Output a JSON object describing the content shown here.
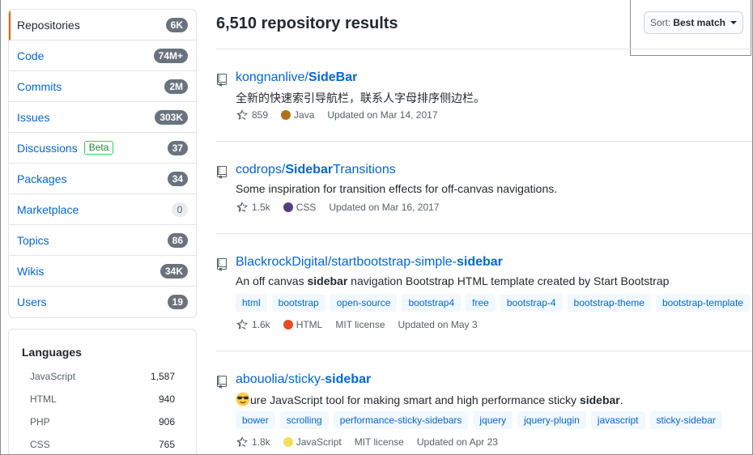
{
  "sidebar": {
    "items": [
      {
        "label": "Repositories",
        "count": "6K"
      },
      {
        "label": "Code",
        "count": "74M+"
      },
      {
        "label": "Commits",
        "count": "2M"
      },
      {
        "label": "Issues",
        "count": "303K"
      },
      {
        "label": "Discussions",
        "badge": "Beta",
        "count": "37"
      },
      {
        "label": "Packages",
        "count": "34"
      },
      {
        "label": "Marketplace",
        "count": "0"
      },
      {
        "label": "Topics",
        "count": "86"
      },
      {
        "label": "Wikis",
        "count": "34K"
      },
      {
        "label": "Users",
        "count": "19"
      }
    ]
  },
  "languages": {
    "title": "Languages",
    "items": [
      {
        "name": "JavaScript",
        "count": "1,587"
      },
      {
        "name": "HTML",
        "count": "940"
      },
      {
        "name": "PHP",
        "count": "906"
      },
      {
        "name": "CSS",
        "count": "765"
      }
    ]
  },
  "results": {
    "title": "6,510 repository results",
    "sort_prefix": "Sort:",
    "sort_value": "Best match"
  },
  "repos": [
    {
      "owner": "kongnanlive/",
      "name_match": "SideBar",
      "name_rest": "",
      "desc": "全新的快速索引导航栏，联系人字母排序侧边栏。",
      "stars": "859",
      "language": "Java",
      "lang_color": "#b07219",
      "license": "",
      "updated": "Updated on Mar 14, 2017",
      "topics": []
    },
    {
      "owner": "codrops/",
      "name_match": "Sidebar",
      "name_rest": "Transitions",
      "desc": "Some inspiration for transition effects for off-canvas navigations.",
      "stars": "1.5k",
      "language": "CSS",
      "lang_color": "#563d7c",
      "license": "",
      "updated": "Updated on Mar 16, 2017",
      "topics": []
    },
    {
      "owner": "BlackrockDigital/startbootstrap-simple-",
      "name_match": "sidebar",
      "name_rest": "",
      "desc_pre": "An off canvas ",
      "desc_bold": "sidebar",
      "desc_post": " navigation Bootstrap HTML template created by Start Bootstrap",
      "stars": "1.6k",
      "language": "HTML",
      "lang_color": "#e34c26",
      "license": "MIT license",
      "updated": "Updated on May 3",
      "topics": [
        "html",
        "bootstrap",
        "open-source",
        "bootstrap4",
        "free",
        "bootstrap-4",
        "bootstrap-theme",
        "bootstrap-template"
      ]
    },
    {
      "owner": "abouolia/sticky-",
      "name_match": "sidebar",
      "name_rest": "",
      "desc_pre": "ure JavaScript tool for making smart and high performance sticky ",
      "desc_bold": "sidebar",
      "desc_post": ".",
      "stars": "1.8k",
      "language": "JavaScript",
      "lang_color": "#f1e05a",
      "license": "MIT license",
      "updated": "Updated on Apr 23",
      "topics": [
        "bower",
        "scrolling",
        "performance-sticky-sidebars",
        "jquery",
        "jquery-plugin",
        "javascript",
        "sticky-sidebar"
      ]
    }
  ]
}
